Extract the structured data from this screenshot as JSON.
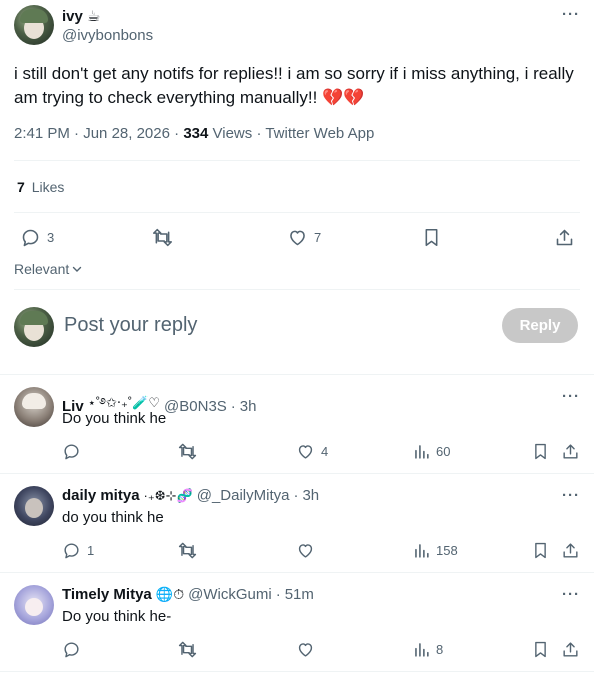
{
  "tweet": {
    "author_name": "ivy",
    "author_emoji": "☕",
    "author_handle": "@ivybonbons",
    "text": "i still don't get any notifs for replies!! i am so sorry if i miss anything, i really am trying to check everything manually!! 💔💔",
    "time": "2:41 PM",
    "date": "Jun 28, 2026",
    "views_count": "334",
    "views_label": "Views",
    "source": "Twitter Web App",
    "likes_count": "7",
    "likes_label": "Likes",
    "reply_count": "3",
    "like_count_action": "7"
  },
  "sort": {
    "label": "Relevant"
  },
  "composer": {
    "placeholder": "Post your reply",
    "button_label": "Reply"
  },
  "replies": [
    {
      "name": "Liv",
      "name_suffix": "⋆˚࿔✩‧₊˚🧪♡",
      "handle": "@B0N3S",
      "time": "3h",
      "text": "Do you think he",
      "replies": "",
      "likes": "4",
      "views": "60"
    },
    {
      "name": "daily mitya",
      "name_suffix": "·₊❆⊹🧬",
      "handle": "@_DailyMitya",
      "time": "3h",
      "text": "do you think he",
      "replies": "1",
      "likes": "",
      "views": "158"
    },
    {
      "name": "Timely Mitya",
      "name_suffix": "🌐⏱",
      "handle": "@WickGumi",
      "time": "51m",
      "text": "Do you think he-",
      "replies": "",
      "likes": "",
      "views": "8"
    }
  ],
  "icons": {
    "more": "more-icon",
    "reply": "reply-icon",
    "retweet": "retweet-icon",
    "like": "heart-icon",
    "bookmark": "bookmark-icon",
    "share": "share-icon",
    "views": "views-icon",
    "chevron": "chevron-down-icon"
  },
  "colors": {
    "text": "#0f1419",
    "muted": "#536471",
    "divider": "#eff3f4",
    "reply_button_disabled": "#8ecdf8"
  }
}
